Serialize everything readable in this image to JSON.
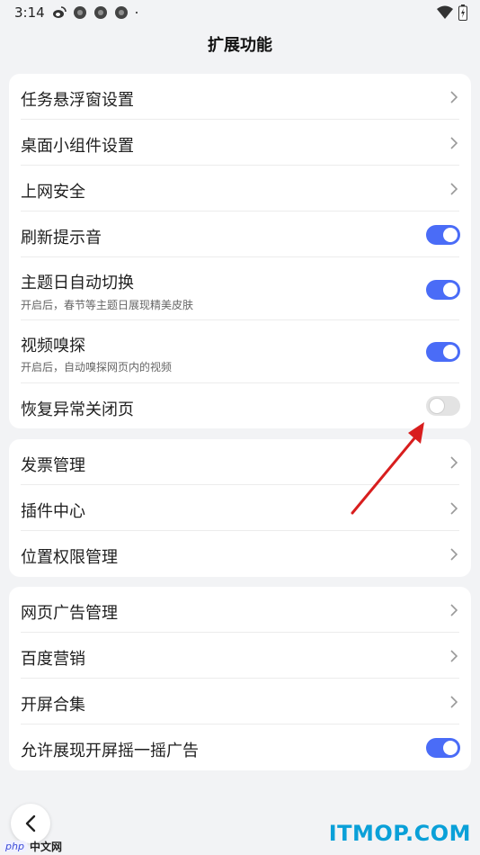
{
  "status_bar": {
    "time": "3:14",
    "icons": [
      "weibo-icon",
      "app-icon",
      "app-icon",
      "app-icon",
      "dot-icon"
    ],
    "right_icons": [
      "wifi-icon",
      "battery-icon"
    ]
  },
  "page": {
    "title": "扩展功能"
  },
  "sections": [
    {
      "rows": [
        {
          "label": "任务悬浮窗设置",
          "control": "chevron"
        },
        {
          "label": "桌面小组件设置",
          "control": "chevron"
        },
        {
          "label": "上网安全",
          "control": "chevron"
        },
        {
          "label": "刷新提示音",
          "control": "toggle",
          "on": true
        },
        {
          "label": "主题日自动切换",
          "sub": "开启后，春节等主题日展现精美皮肤",
          "control": "toggle",
          "on": true
        },
        {
          "label": "视频嗅探",
          "sub": "开启后，自动嗅探网页内的视频",
          "control": "toggle",
          "on": true
        },
        {
          "label": "恢复异常关闭页",
          "control": "toggle",
          "on": false
        }
      ]
    },
    {
      "rows": [
        {
          "label": "发票管理",
          "control": "chevron"
        },
        {
          "label": "插件中心",
          "control": "chevron"
        },
        {
          "label": "位置权限管理",
          "control": "chevron"
        }
      ]
    },
    {
      "rows": [
        {
          "label": "网页广告管理",
          "control": "chevron"
        },
        {
          "label": "百度营销",
          "control": "chevron"
        },
        {
          "label": "开屏合集",
          "control": "chevron"
        },
        {
          "label": "允许展现开屏摇一摇广告",
          "control": "toggle",
          "on": true
        }
      ]
    }
  ],
  "nav": {
    "back_icon": "chevron-left-icon"
  },
  "watermarks": {
    "left_badge": "php",
    "left_text": "中文网",
    "right_text": "ITMOP.COM"
  },
  "colors": {
    "accent": "#4a6cf7",
    "background": "#f2f3f5",
    "toggle_off": "#e3e3e3",
    "annotation_arrow": "#d81e1e",
    "watermark": "#0aa0d8"
  }
}
